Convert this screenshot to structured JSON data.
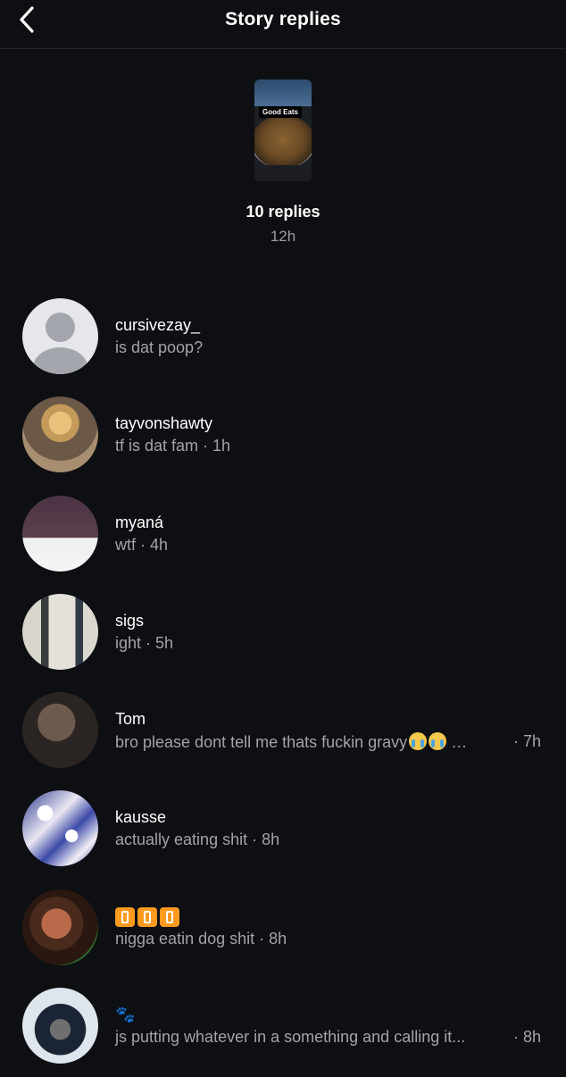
{
  "header": {
    "title": "Story replies"
  },
  "story": {
    "sticker_text": "Good Eats",
    "reply_count": "10 replies",
    "time": "12h"
  },
  "replies": [
    {
      "username": "cursivezay_",
      "message": "is dat poop?",
      "time": ""
    },
    {
      "username": "tayvonshawty",
      "message": "tf is dat fam · 1h",
      "time": ""
    },
    {
      "username": "myaná",
      "message": "wtf · 4h",
      "time": ""
    },
    {
      "username": "sigs",
      "message": "ight · 5h",
      "time": ""
    },
    {
      "username": "Tom",
      "message": "bro please dont tell me thats fuckin gravy",
      "time": "· 7h"
    },
    {
      "username": "kausse",
      "message": "actually eating shit · 8h",
      "time": ""
    },
    {
      "username": "",
      "message": "nigga eatin dog shit · 8h",
      "time": ""
    },
    {
      "username": "",
      "message": "js putting whatever in a something and calling it...",
      "time": "· 8h"
    }
  ]
}
